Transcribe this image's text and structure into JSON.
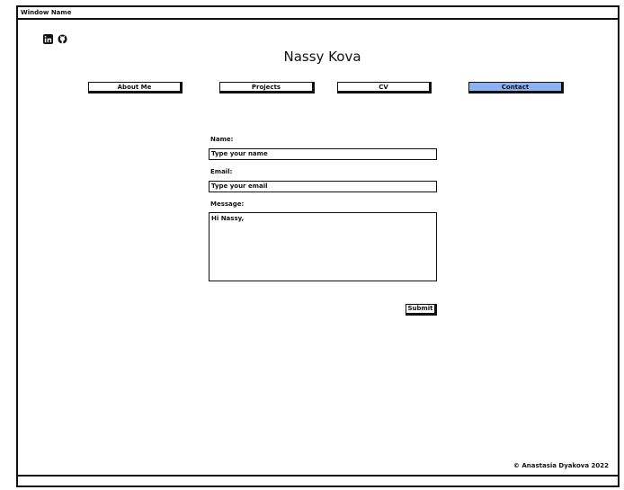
{
  "window": {
    "title": "Window Name"
  },
  "header": {
    "social": [
      {
        "icon": "linkedin-icon"
      },
      {
        "icon": "github-icon"
      }
    ],
    "site_title": "Nassy Kova"
  },
  "nav": {
    "items": [
      {
        "label": "About Me",
        "active": false
      },
      {
        "label": "Projects",
        "active": false
      },
      {
        "label": "CV",
        "active": false
      },
      {
        "label": "Contact",
        "active": true
      }
    ],
    "active_color": "#8db1f2"
  },
  "form": {
    "name_label": "Name:",
    "name_placeholder": "Type your name",
    "email_label": "Email:",
    "email_placeholder": "Type your email",
    "message_label": "Message:",
    "message_value": "Hi Nassy,",
    "submit_label": "Submit"
  },
  "footer": {
    "copyright": "© Anastasia Dyakova 2022"
  }
}
